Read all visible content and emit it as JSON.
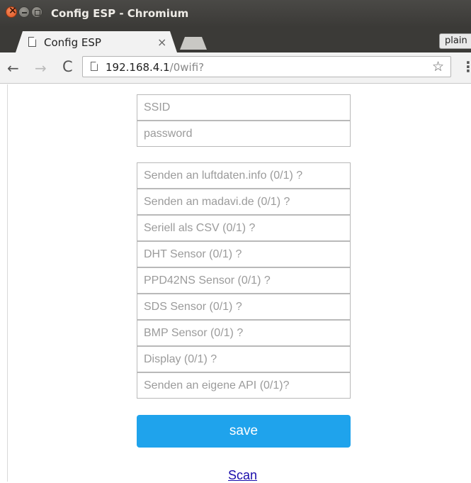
{
  "window": {
    "title": "Config ESP - Chromium"
  },
  "tabs": [
    {
      "label": "Config ESP",
      "close_glyph": "×"
    }
  ],
  "profile": {
    "label": "plain"
  },
  "toolbar": {
    "back_glyph": "←",
    "forward_glyph": "→",
    "reload_glyph": "C",
    "url_host": "192.168.4.1",
    "url_path": "/0wifi?",
    "star_glyph": "☆",
    "menu_glyph": "⋮"
  },
  "form": {
    "wifi_fields": [
      {
        "placeholder": "SSID",
        "value": ""
      },
      {
        "placeholder": "password",
        "value": ""
      }
    ],
    "option_fields": [
      {
        "placeholder": "Senden an luftdaten.info (0/1) ?",
        "value": ""
      },
      {
        "placeholder": "Senden an madavi.de (0/1) ?",
        "value": ""
      },
      {
        "placeholder": "Seriell als CSV (0/1) ?",
        "value": ""
      },
      {
        "placeholder": "DHT Sensor (0/1) ?",
        "value": ""
      },
      {
        "placeholder": "PPD42NS Sensor (0/1) ?",
        "value": ""
      },
      {
        "placeholder": "SDS Sensor (0/1) ?",
        "value": ""
      },
      {
        "placeholder": "BMP Sensor (0/1) ?",
        "value": ""
      },
      {
        "placeholder": "Display (0/1) ?",
        "value": ""
      },
      {
        "placeholder": "Senden an eigene API (0/1)?",
        "value": ""
      }
    ],
    "save_label": "save",
    "scan_label": "Scan"
  },
  "colors": {
    "accent": "#1fa3ec",
    "link": "#1a0dab"
  },
  "icons": [
    "close-window-icon",
    "minimize-icon",
    "maximize-icon",
    "page-icon",
    "back-arrow-icon",
    "forward-arrow-icon",
    "reload-icon",
    "star-icon",
    "menu-icon"
  ]
}
